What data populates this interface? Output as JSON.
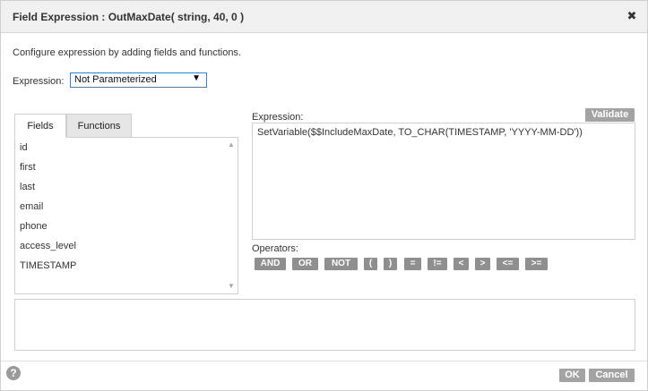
{
  "dialog": {
    "title": "Field Expression : OutMaxDate( string, 40, 0 )",
    "close_glyph": "✖",
    "description": "Configure expression by adding fields and functions."
  },
  "expression_select": {
    "label": "Expression:",
    "value": "Not Parameterized",
    "arrow": "▼"
  },
  "tabs": [
    {
      "label": "Fields",
      "active": true
    },
    {
      "label": "Functions",
      "active": false
    }
  ],
  "fields": [
    "id",
    "first",
    "last",
    "email",
    "phone",
    "access_level",
    "TIMESTAMP"
  ],
  "scrollbar": {
    "up": "▲",
    "down": "▼"
  },
  "editor": {
    "label": "Expression:",
    "validate_label": "Validate",
    "text": "SetVariable($$IncludeMaxDate, TO_CHAR(TIMESTAMP, 'YYYY-MM-DD'))"
  },
  "operators": {
    "label": "Operators:",
    "items": [
      "AND",
      "OR",
      "NOT",
      "(",
      ")",
      "=",
      "!=",
      "<",
      ">",
      "<=",
      ">="
    ]
  },
  "footer": {
    "help_glyph": "?",
    "ok_label": "OK",
    "cancel_label": "Cancel"
  },
  "icons": {
    "close": "close-icon",
    "help": "help-icon",
    "dropdown": "chevron-down-icon",
    "scroll_up": "scroll-up-icon",
    "scroll_down": "scroll-down-icon"
  },
  "colors": {
    "button_gray": "#a3a3a3",
    "operator_gray": "#8f8f8f",
    "select_border": "#3c7fc3",
    "titlebar_bg": "#f0f0f0"
  }
}
